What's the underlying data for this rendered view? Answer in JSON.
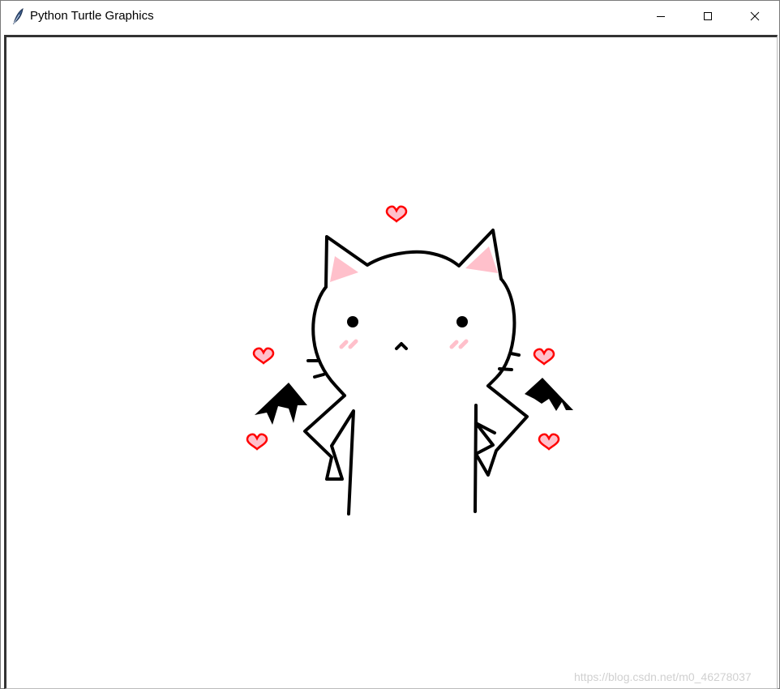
{
  "window": {
    "title": "Python Turtle Graphics",
    "controls": {
      "minimize": "minimize",
      "maximize": "maximize",
      "close": "close"
    }
  },
  "canvas": {
    "background": "#ffffff",
    "ink_color": "#000000",
    "blush_color": "#ffc0cb",
    "heart_outline_color": "#ff0000",
    "heart_fill_color": "#ffc0cb"
  },
  "watermark": "https://blog.csdn.net/m0_46278037"
}
